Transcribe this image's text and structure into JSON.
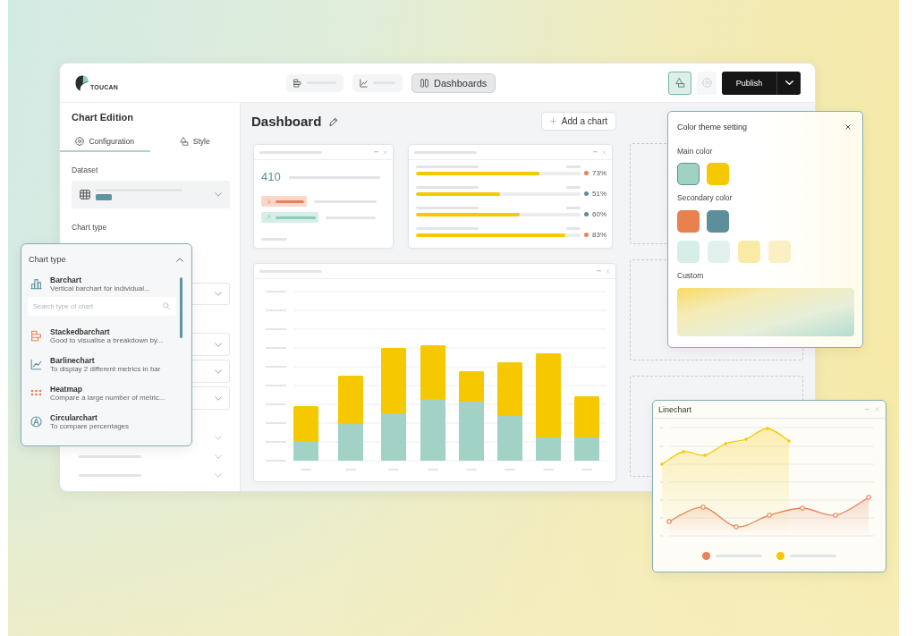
{
  "logo": {
    "text": "TOUCAN"
  },
  "nav_tabs": [
    {
      "kind": "stacked",
      "selected": false
    },
    {
      "kind": "line",
      "selected": false
    },
    {
      "kind": "dashboards",
      "label": "Dashboards",
      "selected": true
    }
  ],
  "tools": [
    {
      "kind": "style",
      "selected": true
    },
    {
      "kind": "settings",
      "selected": false
    }
  ],
  "publish_button": {
    "label": "Publish"
  },
  "sidebar": {
    "title": "Chart Edition",
    "tabs": [
      {
        "kind": "configuration",
        "label": "Configuration",
        "selected": true
      },
      {
        "kind": "style",
        "label": "Style",
        "selected": false
      }
    ],
    "dataset_label": "Dataset",
    "chart_type_label": "Chart type"
  },
  "chart_type_menu": {
    "title": "Chart type",
    "expanded": true,
    "current": {
      "kind": "bar",
      "title": "Barchart",
      "description": "Vertical barchart for individual..."
    },
    "search": {
      "placeholder": "Search type of chart"
    },
    "options": [
      {
        "kind": "stacked",
        "title": "Stackedbarchart",
        "description": "Good to visualise a breakdown by..."
      },
      {
        "kind": "barline",
        "title": "Barlinechart",
        "description": "To display 2 different metrics in bar"
      },
      {
        "kind": "heatmap",
        "title": "Heatmap",
        "description": "Compare a large number of metric..."
      },
      {
        "kind": "circular",
        "title": "Circularchart",
        "description": "To compare percentages"
      }
    ]
  },
  "dashboard": {
    "title": "Dashboard",
    "add_button": "Add a chart",
    "kpi_card": {
      "value": "410"
    },
    "progress_card": {
      "rows": [
        {
          "level": 0.75,
          "color": "#e8825a",
          "reading": "73%"
        },
        {
          "level": 0.51,
          "color": "#5b8e9c",
          "reading": "51%"
        },
        {
          "level": 0.63,
          "color": "#5b8e9c",
          "reading": "60%"
        },
        {
          "level": 0.91,
          "color": "#e8825a",
          "reading": "83%"
        }
      ]
    }
  },
  "color_theme": {
    "title": "Color theme setting",
    "main_label": "Main color",
    "main_colors": [
      {
        "color": "#a0d2c4",
        "selected": true
      },
      {
        "color": "#f5c800",
        "selected": false
      }
    ],
    "secondary_label": "Secondary color",
    "secondary_colors": [
      {
        "color": "#e8804f",
        "selected": false
      },
      {
        "color": "#5d8f9b",
        "selected": false
      }
    ],
    "tint_colors": [
      {
        "color": "#d6eee8",
        "selected": false
      },
      {
        "color": "#e2f1ee",
        "selected": false
      },
      {
        "color": "#f9eaa5",
        "selected": false
      },
      {
        "color": "#fbf0c3",
        "selected": false
      }
    ],
    "custom_label": "Custom"
  },
  "linechart_panel": {
    "title": "Linechart",
    "legend": [
      {
        "color": "#e8825a"
      },
      {
        "color": "#f5c800"
      }
    ]
  }
}
